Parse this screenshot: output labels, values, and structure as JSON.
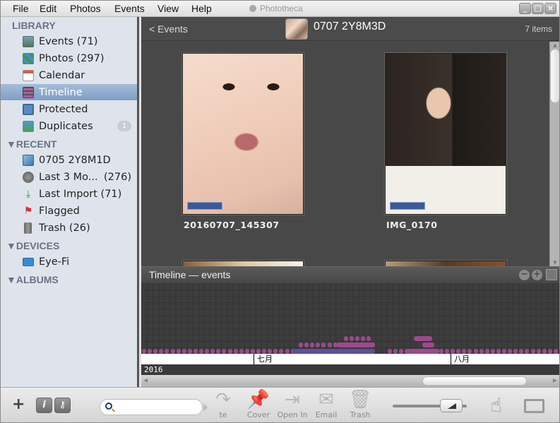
{
  "app": {
    "title": "Phototheca"
  },
  "menu": [
    "File",
    "Edit",
    "Photos",
    "Events",
    "View",
    "Help"
  ],
  "window_buttons": [
    "minimize",
    "maximize",
    "close"
  ],
  "sidebar": {
    "sections": {
      "library": "LIBRARY",
      "recent": "RECENT",
      "devices": "DEVICES",
      "albums": "ALBUMS"
    },
    "library_items": [
      {
        "label": "Events (71)",
        "icon": "events-icon"
      },
      {
        "label": "Photos (297)",
        "icon": "photos-icon"
      },
      {
        "label": "Calendar",
        "icon": "calendar-icon"
      },
      {
        "label": "Timeline",
        "icon": "timeline-icon",
        "selected": true
      },
      {
        "label": "Protected",
        "icon": "protected-icon"
      },
      {
        "label": "Duplicates",
        "icon": "duplicates-icon",
        "badge": "1"
      }
    ],
    "recent_items": [
      {
        "label": "0705 2Y8M1D",
        "icon": "event-album-icon"
      },
      {
        "label": "Last 3 Mo...",
        "count": "(276)",
        "icon": "clock-icon"
      },
      {
        "label": "Last Import (71)",
        "icon": "import-icon"
      },
      {
        "label": "Flagged",
        "icon": "flag-icon"
      },
      {
        "label": "Trash (26)",
        "icon": "trash-icon"
      }
    ],
    "device_items": [
      {
        "label": "Eye-Fi",
        "icon": "eyefi-icon"
      }
    ]
  },
  "header": {
    "back_label": "<  Events",
    "event_title": "0707 2Y8M3D",
    "item_count": "7 items"
  },
  "photos": [
    {
      "name": "20160707_145307"
    },
    {
      "name": "IMG_0170"
    }
  ],
  "timeline": {
    "title": "Timeline — events",
    "zoom_out": "−",
    "zoom_in": "+",
    "months": [
      "七月",
      "八月"
    ],
    "year": "2016",
    "colors": {
      "event": "#9c4a8c",
      "selected": "#5b4fa0",
      "empty": "#3d3d3d"
    }
  },
  "toolbar": {
    "search_placeholder": "",
    "tools": [
      {
        "label": "te",
        "icon": "share-icon"
      },
      {
        "label": "Cover",
        "icon": "pin-icon"
      },
      {
        "label": "Open In",
        "icon": "open-in-icon"
      },
      {
        "label": "Email",
        "icon": "email-icon"
      },
      {
        "label": "Trash",
        "icon": "trash-icon"
      }
    ],
    "zoom_level": 0.75
  }
}
